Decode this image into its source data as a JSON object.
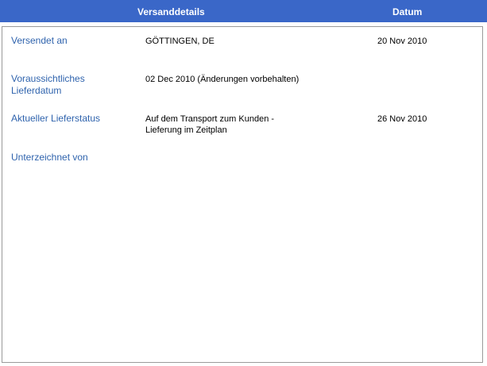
{
  "header": {
    "title": "Versanddetails",
    "date_label": "Datum"
  },
  "rows": [
    {
      "label": "Versendet an",
      "value": "GÖTTINGEN, DE",
      "date": "20 Nov 2010"
    },
    {
      "label": "Voraussichtliches Lieferdatum",
      "value": "02 Dec 2010 (Änderungen vorbehalten)",
      "date": ""
    },
    {
      "label": "Aktueller Lieferstatus",
      "value": "Auf dem Transport zum Kunden - Lieferung im Zeitplan",
      "date": "26 Nov 2010"
    },
    {
      "label": "Unterzeichnet von",
      "value": "",
      "date": ""
    }
  ],
  "colors": {
    "header_bg": "#3a67c8",
    "label_text": "#2f63ad",
    "border": "#9a9a9a"
  }
}
